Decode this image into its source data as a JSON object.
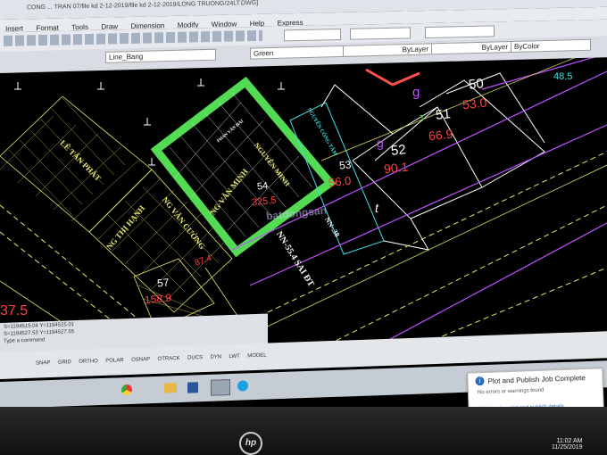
{
  "window": {
    "title": "CONG ... TRAN 07/file kd 2-12-2019/file kd 2-12-2019/LONG TRUONG/24LT.DWG]"
  },
  "menu": [
    "Insert",
    "Format",
    "Tools",
    "Draw",
    "Dimension",
    "Modify",
    "Window",
    "Help",
    "Express"
  ],
  "toolbar": {
    "linetype": "Line_Bang",
    "color": "Green",
    "layer_bylayer": "ByLayer",
    "linetype_bylayer": "ByLayer",
    "lineweight": "ByColor"
  },
  "plots": [
    {
      "id": "50",
      "value": "53.0"
    },
    {
      "id": "51",
      "value": "66.9"
    },
    {
      "id": "52",
      "value": "90.1"
    },
    {
      "id": "53",
      "value": "56.0"
    },
    {
      "id": "54",
      "value": "325.5"
    },
    {
      "id": "57",
      "value": "158.9"
    }
  ],
  "misc_numbers": {
    "top_right": "48.5",
    "left_partial": "37.5",
    "mid_partial": "87.4"
  },
  "owner_labels": {
    "nguyen_minh": "NG VĂN MINH",
    "nguyen_minh2": "NGUYỄN MINH",
    "nguyen_cuong": "NG VĂN CƯỜNG",
    "ng_thi_hanh": "NG THỊ HẠNH",
    "le_tan_phat": "LÊ TẤN PHÁT",
    "cong_tam": "NGUYỄN CÔNG TÂM",
    "phan_van_hai": "PHAN VĂN HẢI"
  },
  "road_labels": {
    "nn55": "NN-55.4 SAI ĐT",
    "nn38": "NN-.38",
    "t": "t",
    "g1": "g",
    "g2": "g",
    "t2": "T"
  },
  "watermark": "batdongsan",
  "command_lines": [
    "S=1194515.04   Y=1194515.01",
    "S=1194527.53   Y=1194527.55",
    "Type a command"
  ],
  "status_items": [
    "SNAP",
    "GRID",
    "ORTHO",
    "POLAR",
    "OSNAP",
    "OTRACK",
    "DUCS",
    "DYN",
    "LWT",
    "MODEL"
  ],
  "notification": {
    "title": "Plot and Publish Job Complete",
    "line1": "No errors or warnings found",
    "line2": "Click to view plot and publish details"
  },
  "clock": {
    "time": "11:02 AM",
    "date": "11/25/2019"
  },
  "brand": "hp",
  "colors": {
    "cad_bg": "#000000",
    "highlight": "#5cf35c",
    "parcel_yellow": "#e8e870",
    "white": "#ffffff",
    "red_text": "#ff4040",
    "cyan": "#40e0e0",
    "magenta": "#c050ff"
  }
}
